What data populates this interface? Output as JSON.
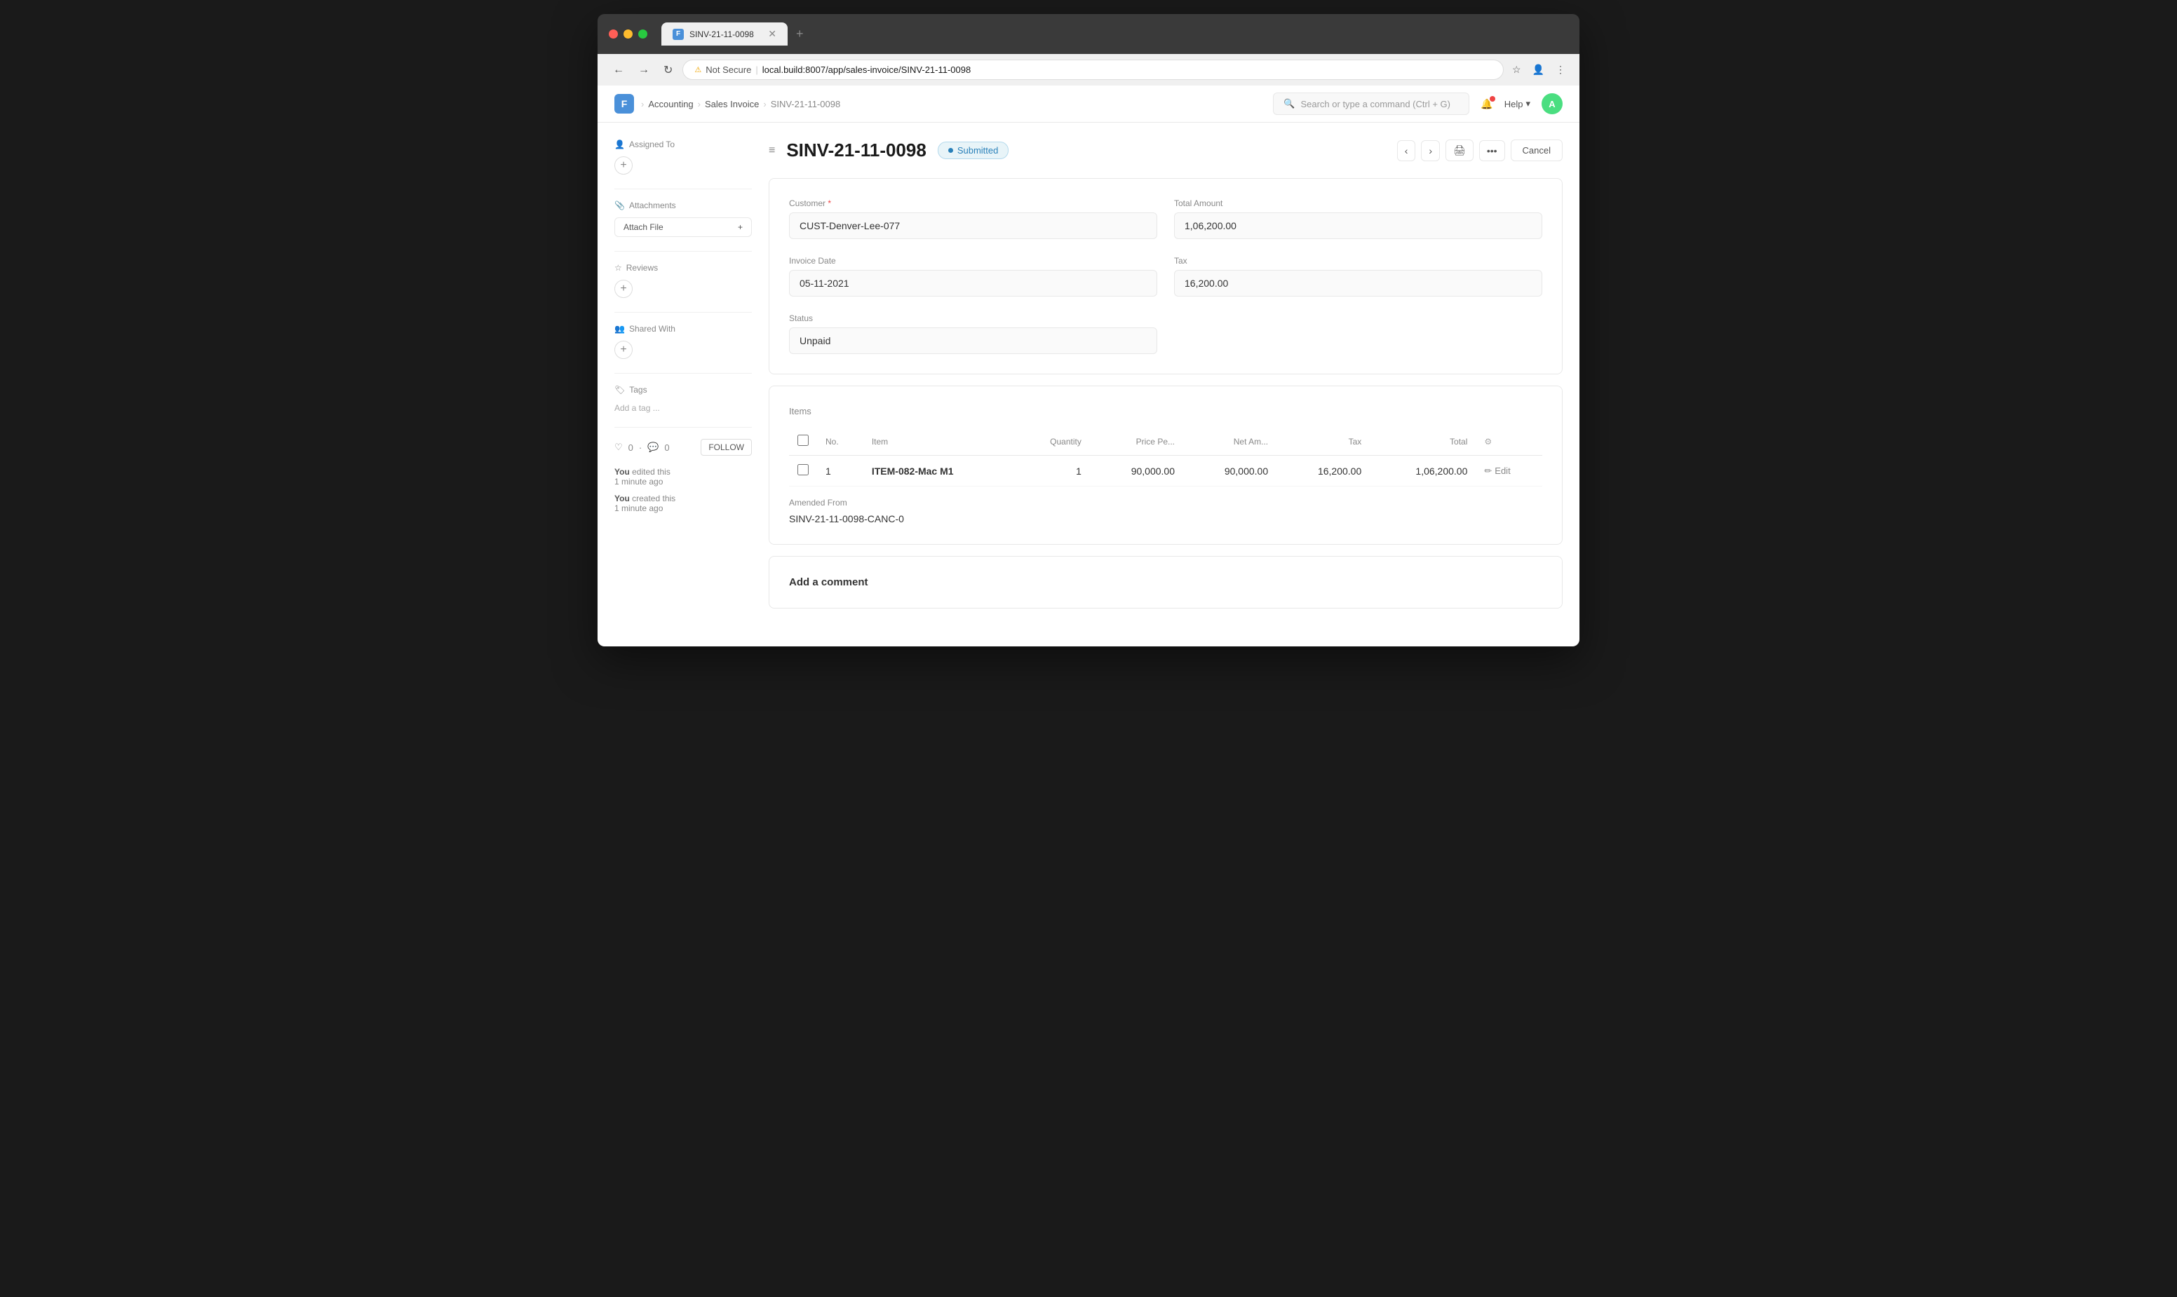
{
  "browser": {
    "tab_title": "SINV-21-11-0098",
    "tab_favicon": "F",
    "url_warning": "Not Secure",
    "url_base": "local.build",
    "url_port": "8007",
    "url_path": "/app/sales-invoice/SINV-21-11-0098",
    "url_display": "local.build:8007/app/sales-invoice/SINV-21-11-0098"
  },
  "app": {
    "logo": "F",
    "search_placeholder": "Search or type a command (Ctrl + G)",
    "help_label": "Help",
    "avatar_initials": "A"
  },
  "breadcrumb": {
    "root": "Accounting",
    "parent": "Sales Invoice",
    "current": "SINV-21-11-0098"
  },
  "page": {
    "title": "SINV-21-11-0098",
    "status": "Submitted",
    "cancel_label": "Cancel"
  },
  "sidebar": {
    "assigned_to_label": "Assigned To",
    "attachments_label": "Attachments",
    "attach_file_label": "Attach File",
    "reviews_label": "Reviews",
    "shared_with_label": "Shared With",
    "tags_label": "Tags",
    "add_tag_placeholder": "Add a tag ...",
    "likes_count": "0",
    "comments_count": "0",
    "follow_label": "FOLLOW",
    "activity": [
      {
        "user": "You",
        "action": "edited this",
        "time": "1 minute ago"
      },
      {
        "user": "You",
        "action": "created this",
        "time": "1 minute ago"
      }
    ]
  },
  "form": {
    "customer_label": "Customer",
    "customer_required": true,
    "customer_value": "CUST-Denver-Lee-077",
    "total_amount_label": "Total Amount",
    "total_amount_value": "1,06,200.00",
    "invoice_date_label": "Invoice Date",
    "invoice_date_value": "05-11-2021",
    "tax_label": "Tax",
    "tax_value": "16,200.00",
    "status_label": "Status",
    "status_value": "Unpaid"
  },
  "items": {
    "section_label": "Items",
    "columns": {
      "no": "No.",
      "item": "Item",
      "quantity": "Quantity",
      "price_per": "Price Pe...",
      "net_amount": "Net Am...",
      "tax": "Tax",
      "total": "Total"
    },
    "rows": [
      {
        "no": "1",
        "item": "ITEM-082-Mac M1",
        "quantity": "1",
        "price_per": "90,000.00",
        "net_amount": "90,000.00",
        "tax": "16,200.00",
        "total": "1,06,200.00",
        "edit_label": "Edit"
      }
    ]
  },
  "amended": {
    "label": "Amended From",
    "value": "SINV-21-11-0098-CANC-0"
  },
  "comment_section": {
    "title": "Add a comment"
  }
}
